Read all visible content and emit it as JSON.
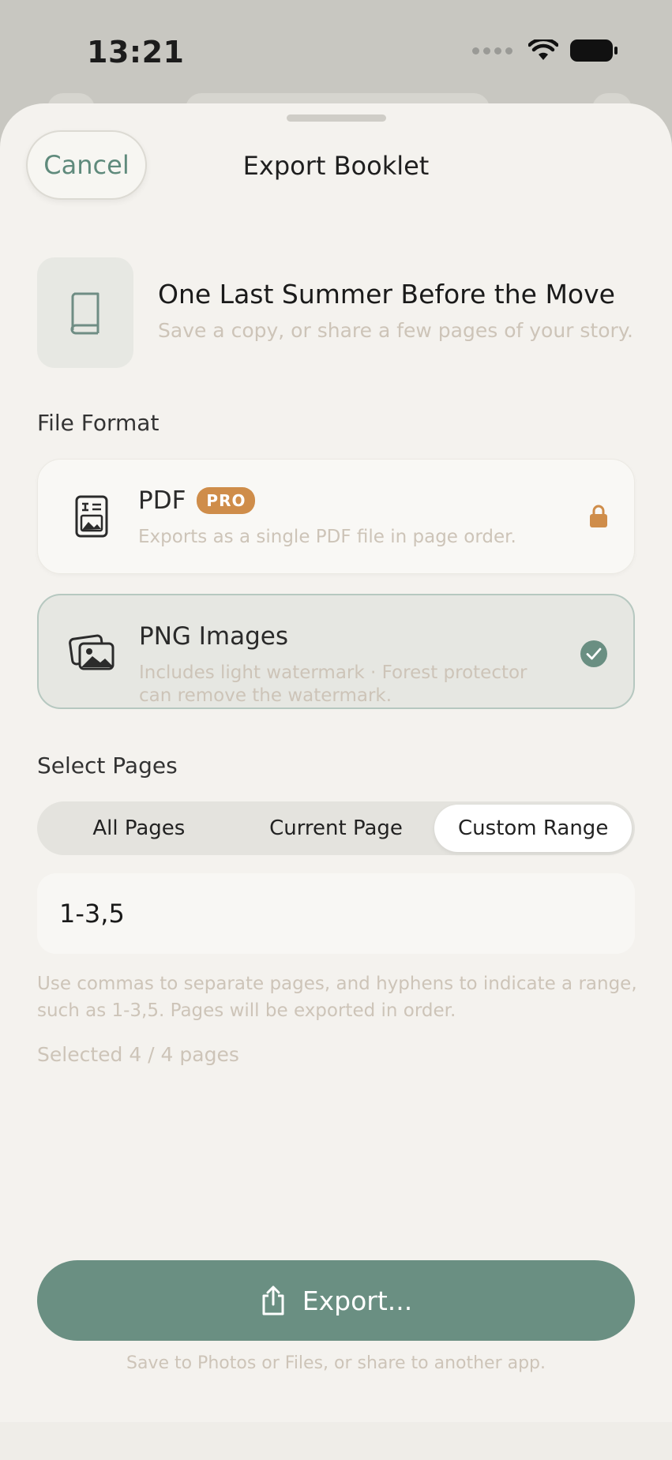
{
  "status": {
    "time": "13:21"
  },
  "header": {
    "cancel_label": "Cancel",
    "title": "Export Booklet"
  },
  "booklet": {
    "title": "One Last Summer Before the Move",
    "subtitle": "Save a copy, or share a few pages of your story."
  },
  "file_format": {
    "label": "File Format",
    "options": [
      {
        "name": "PDF",
        "badge": "PRO",
        "description": "Exports as a single PDF file in page order.",
        "locked": true
      },
      {
        "name": "PNG Images",
        "description": "Includes light watermark · Forest protector can remove the watermark.",
        "selected": true
      }
    ]
  },
  "pages": {
    "label": "Select Pages",
    "tabs": [
      "All Pages",
      "Current Page",
      "Custom Range"
    ],
    "active_tab": "Custom Range",
    "range_value": "1-3,5",
    "hint": "Use commas to separate pages, and hyphens to indicate a range, such as 1-3,5. Pages will be exported in order.",
    "selected_count": "Selected 4 / 4 pages"
  },
  "export": {
    "label": "Export...",
    "note": "Save to Photos or Files, or share to another app."
  },
  "colors": {
    "accent": "#6a8f82",
    "pro": "#cf8d4a",
    "muted_text": "#cdc4b8"
  }
}
